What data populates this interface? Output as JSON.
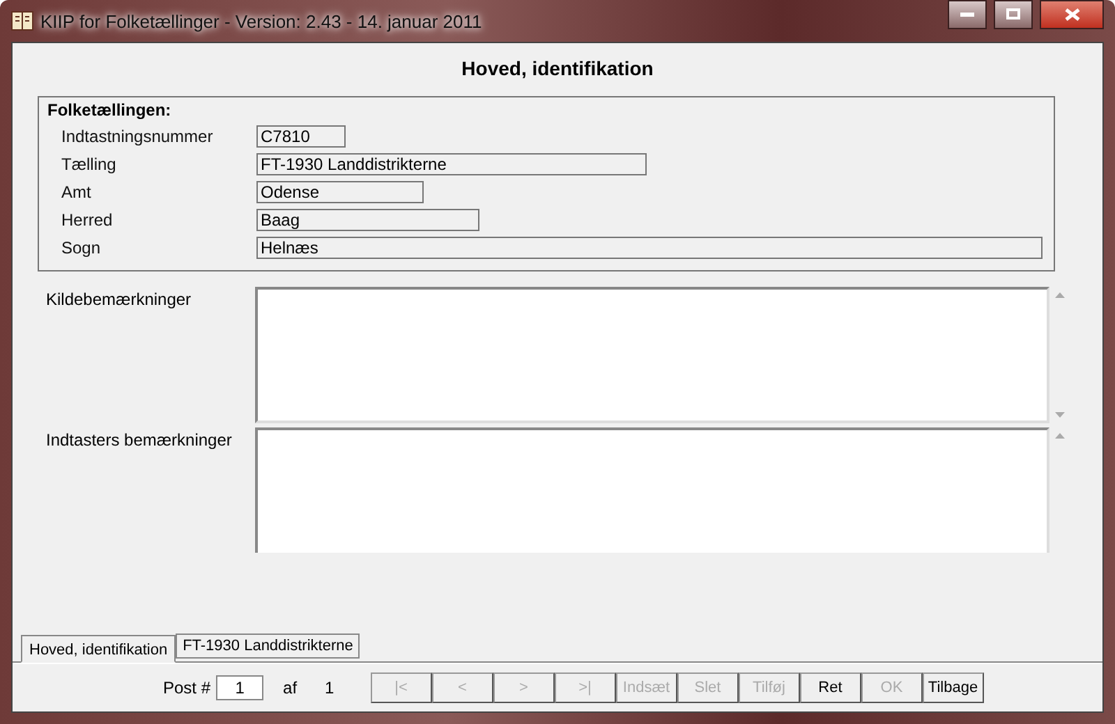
{
  "window": {
    "title": "KIIP for Folketællinger - Version: 2.43 - 14. januar 2011"
  },
  "heading": "Hoved, identifikation",
  "group": {
    "title": "Folketællingen:",
    "fields": [
      {
        "label": "Indtastningsnummer",
        "value": "C7810"
      },
      {
        "label": "Tælling",
        "value": "FT-1930 Landdistrikterne"
      },
      {
        "label": "Amt",
        "value": "Odense"
      },
      {
        "label": "Herred",
        "value": "Baag"
      },
      {
        "label": "Sogn",
        "value": "Helnæs"
      }
    ]
  },
  "remarks": [
    {
      "label": "Kildebemærkninger"
    },
    {
      "label": "Indtasters bemærkninger"
    }
  ],
  "tabs": [
    {
      "label": "Hoved, identifikation",
      "selected": true
    },
    {
      "label": "FT-1930 Landdistrikterne",
      "selected": false
    }
  ],
  "navigator": {
    "label": "Post #",
    "value": "1",
    "of_label": "af",
    "total": "1",
    "buttons": [
      {
        "label": "|<",
        "disabled": true
      },
      {
        "label": "<",
        "disabled": true
      },
      {
        "label": ">",
        "disabled": true
      },
      {
        "label": ">|",
        "disabled": true
      },
      {
        "label": "Indsæt",
        "disabled": true
      },
      {
        "label": "Slet",
        "disabled": true
      },
      {
        "label": "Tilføj",
        "disabled": true
      },
      {
        "label": "Ret",
        "disabled": false
      },
      {
        "label": "OK",
        "disabled": true
      },
      {
        "label": "Tilbage",
        "disabled": false
      }
    ]
  }
}
